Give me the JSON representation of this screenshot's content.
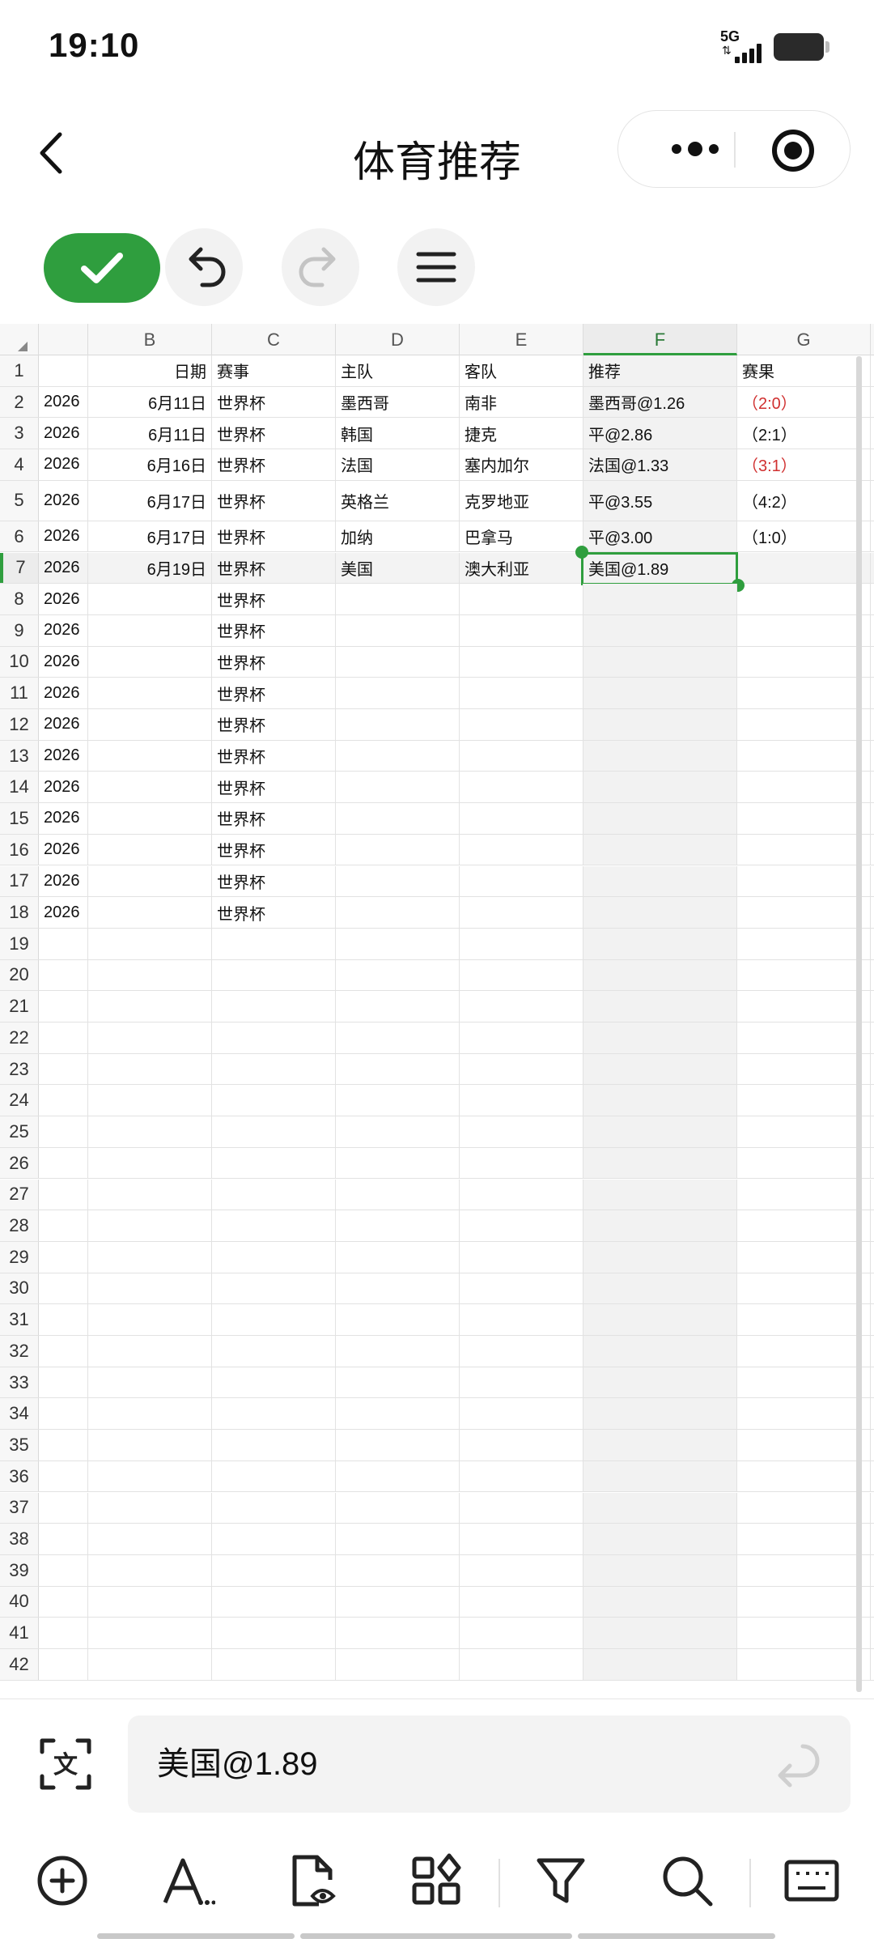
{
  "status": {
    "time": "19:10",
    "network": "5G"
  },
  "header": {
    "title": "体育推荐"
  },
  "sheet": {
    "columns": [
      "B",
      "C",
      "D",
      "E",
      "F",
      "G"
    ],
    "selected_column": "F",
    "rows": [
      {
        "n": "1",
        "a": "",
        "b": "日期",
        "c": "赛事",
        "d": "主队",
        "e": "客队",
        "f": "推荐",
        "g": "赛果"
      },
      {
        "n": "2",
        "a": "2026",
        "b": "6月11日",
        "c": "世界杯",
        "d": "墨西哥",
        "e": "南非",
        "f": "墨西哥@1.26",
        "g": "（2:0）"
      },
      {
        "n": "3",
        "a": "2026",
        "b": "6月11日",
        "c": "世界杯",
        "d": "韩国",
        "e": "捷克",
        "f": "平@2.86",
        "g": "（2:1）"
      },
      {
        "n": "4",
        "a": "2026",
        "b": "6月16日",
        "c": "世界杯",
        "d": "法国",
        "e": "塞内加尔",
        "f": "法国@1.33",
        "g": "（3:1）"
      },
      {
        "n": "5",
        "a": "2026",
        "b": "6月17日",
        "c": "世界杯",
        "d": "英格兰",
        "e": "克罗地亚",
        "f": "平@3.55",
        "g": "（4:2）"
      },
      {
        "n": "6",
        "a": "2026",
        "b": "6月17日",
        "c": "世界杯",
        "d": "加纳",
        "e": "巴拿马",
        "f": "平@3.00",
        "g": "（1:0）"
      },
      {
        "n": "7",
        "a": "2026",
        "b": "6月19日",
        "c": "世界杯",
        "d": "美国",
        "e": "澳大利亚",
        "f": "美国@1.89",
        "g": ""
      },
      {
        "n": "8",
        "a": "2026",
        "b": "",
        "c": "世界杯",
        "d": "",
        "e": "",
        "f": "",
        "g": ""
      },
      {
        "n": "9",
        "a": "2026",
        "b": "",
        "c": "世界杯",
        "d": "",
        "e": "",
        "f": "",
        "g": ""
      },
      {
        "n": "10",
        "a": "2026",
        "b": "",
        "c": "世界杯",
        "d": "",
        "e": "",
        "f": "",
        "g": ""
      },
      {
        "n": "11",
        "a": "2026",
        "b": "",
        "c": "世界杯",
        "d": "",
        "e": "",
        "f": "",
        "g": ""
      },
      {
        "n": "12",
        "a": "2026",
        "b": "",
        "c": "世界杯",
        "d": "",
        "e": "",
        "f": "",
        "g": ""
      },
      {
        "n": "13",
        "a": "2026",
        "b": "",
        "c": "世界杯",
        "d": "",
        "e": "",
        "f": "",
        "g": ""
      },
      {
        "n": "14",
        "a": "2026",
        "b": "",
        "c": "世界杯",
        "d": "",
        "e": "",
        "f": "",
        "g": ""
      },
      {
        "n": "15",
        "a": "2026",
        "b": "",
        "c": "世界杯",
        "d": "",
        "e": "",
        "f": "",
        "g": ""
      },
      {
        "n": "16",
        "a": "2026",
        "b": "",
        "c": "世界杯",
        "d": "",
        "e": "",
        "f": "",
        "g": ""
      },
      {
        "n": "17",
        "a": "2026",
        "b": "",
        "c": "世界杯",
        "d": "",
        "e": "",
        "f": "",
        "g": ""
      },
      {
        "n": "18",
        "a": "2026",
        "b": "",
        "c": "世界杯",
        "d": "",
        "e": "",
        "f": "",
        "g": ""
      },
      {
        "n": "19"
      },
      {
        "n": "20"
      },
      {
        "n": "21"
      },
      {
        "n": "22"
      },
      {
        "n": "23"
      },
      {
        "n": "24"
      },
      {
        "n": "25"
      },
      {
        "n": "26"
      },
      {
        "n": "27"
      },
      {
        "n": "28"
      },
      {
        "n": "29"
      },
      {
        "n": "30"
      },
      {
        "n": "31"
      },
      {
        "n": "32"
      },
      {
        "n": "33"
      },
      {
        "n": "34"
      },
      {
        "n": "35"
      },
      {
        "n": "36"
      },
      {
        "n": "37"
      },
      {
        "n": "38"
      },
      {
        "n": "39"
      },
      {
        "n": "40"
      },
      {
        "n": "41"
      },
      {
        "n": "42"
      }
    ],
    "red_result_rows": [
      "2",
      "4"
    ],
    "active_row": "7",
    "active_cell": "F7"
  },
  "formula_bar": {
    "value": "美国@1.89"
  },
  "icons": {
    "toolbar": [
      "check-icon",
      "undo-icon",
      "redo-icon",
      "menu-icon"
    ],
    "bottom": [
      "add-circle-icon",
      "text-format-icon",
      "file-preview-icon",
      "components-icon",
      "filter-icon",
      "search-icon",
      "keyboard-icon"
    ]
  },
  "colors": {
    "accent": "#2f9e3e",
    "result_red": "#d03030"
  }
}
